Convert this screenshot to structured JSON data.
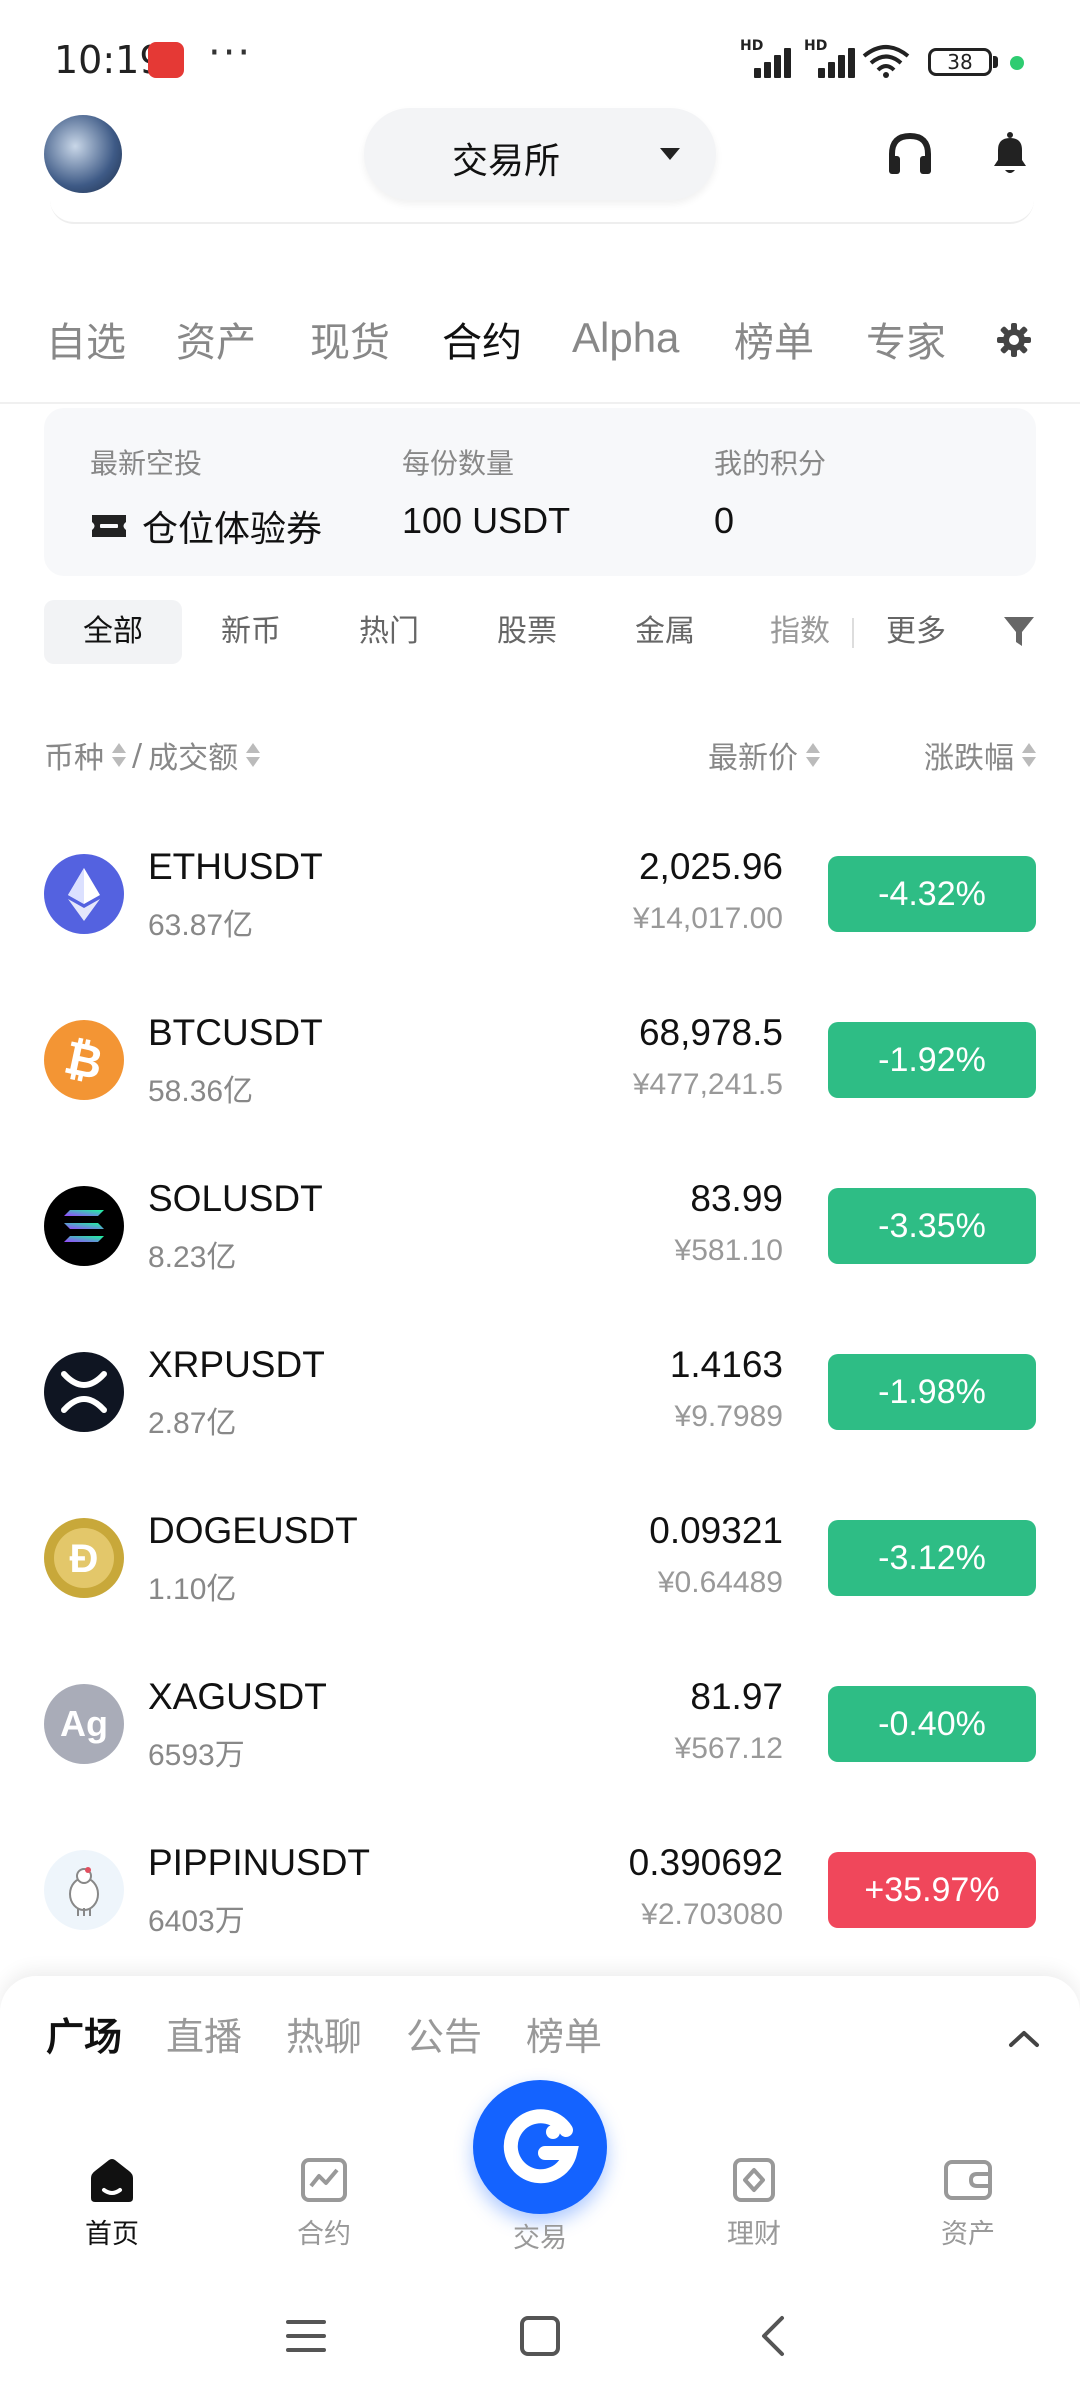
{
  "status_bar": {
    "time": "10:19",
    "dots": "···",
    "battery": "38",
    "hd": "HD"
  },
  "header": {
    "exchange_label": "交易所"
  },
  "top_tabs": [
    "自选",
    "资产",
    "现货",
    "合约",
    "Alpha",
    "榜单",
    "专家"
  ],
  "top_tabs_active": "合约",
  "airdrop": {
    "col1_label": "最新空投",
    "col1_value": "仓位体验券",
    "col2_label": "每份数量",
    "col2_value": "100 USDT",
    "col3_label": "我的积分",
    "col3_value": "0"
  },
  "filters": [
    "全部",
    "新币",
    "热门",
    "股票",
    "金属",
    "指数",
    "更多"
  ],
  "filters_active": "全部",
  "list_header": {
    "coin": "币种",
    "slash": "/",
    "volume": "成交额",
    "price": "最新价",
    "change": "涨跌幅"
  },
  "markets": [
    {
      "symbol": "ETHUSDT",
      "volume": "63.87亿",
      "price": "2,025.96",
      "price_cny": "¥14,017.00",
      "change": "-4.32%",
      "direction": "down",
      "icon": "eth-icon"
    },
    {
      "symbol": "BTCUSDT",
      "volume": "58.36亿",
      "price": "68,978.5",
      "price_cny": "¥477,241.5",
      "change": "-1.92%",
      "direction": "down",
      "icon": "btc-icon"
    },
    {
      "symbol": "SOLUSDT",
      "volume": "8.23亿",
      "price": "83.99",
      "price_cny": "¥581.10",
      "change": "-3.35%",
      "direction": "down",
      "icon": "sol-icon"
    },
    {
      "symbol": "XRPUSDT",
      "volume": "2.87亿",
      "price": "1.4163",
      "price_cny": "¥9.7989",
      "change": "-1.98%",
      "direction": "down",
      "icon": "xrp-icon"
    },
    {
      "symbol": "DOGEUSDT",
      "volume": "1.10亿",
      "price": "0.09321",
      "price_cny": "¥0.64489",
      "change": "-3.12%",
      "direction": "down",
      "icon": "doge-icon"
    },
    {
      "symbol": "XAGUSDT",
      "volume": "6593万",
      "price": "81.97",
      "price_cny": "¥567.12",
      "change": "-0.40%",
      "direction": "down",
      "icon": "xag-icon",
      "logo_text": "Ag"
    },
    {
      "symbol": "PIPPINUSDT",
      "volume": "6403万",
      "price": "0.390692",
      "price_cny": "¥2.703080",
      "change": "+35.97%",
      "direction": "up",
      "icon": "pippin-icon"
    }
  ],
  "sheet_tabs": [
    "广场",
    "直播",
    "热聊",
    "公告",
    "榜单"
  ],
  "sheet_tabs_active": "广场",
  "bottom_nav": {
    "home": "首页",
    "futures": "合约",
    "trade": "交易",
    "earn": "理财",
    "assets": "资产",
    "active": "首页"
  },
  "colors": {
    "down": "#2ebd85",
    "up": "#f0475b",
    "brand": "#1463ff"
  }
}
